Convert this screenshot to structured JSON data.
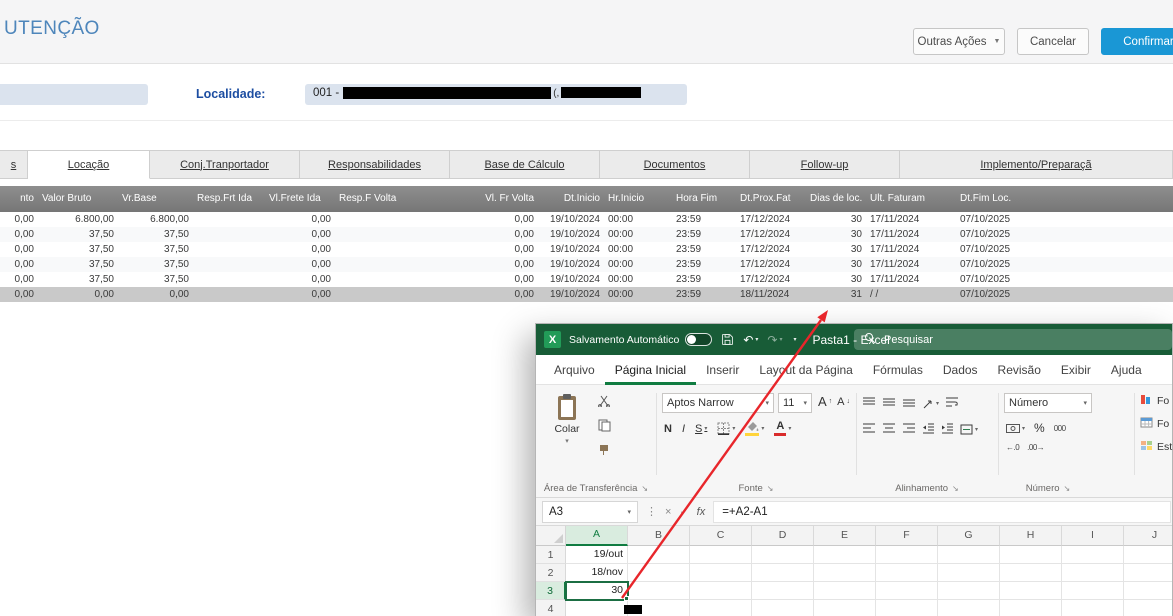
{
  "colors": {
    "accent_blue": "#1a97d5",
    "title_blue": "#4e86bb",
    "label_blue": "#1c4da1",
    "excel_green": "#185c37",
    "excel_accent": "#107c41",
    "arrow_red": "#e8262b",
    "grid_header": "#828282",
    "selected_row": "#c9c9c9",
    "field_bg": "#dbe3ee"
  },
  "header": {
    "title": "UTENÇÃO",
    "outras_acoes_label": "Outras Ações",
    "cancelar_label": "Cancelar",
    "confirmar_label": "Confirmar"
  },
  "form": {
    "localidade_label": "Localidade:",
    "localidade_value": "001 -",
    "redacted_fragment": "(,"
  },
  "tabs": [
    {
      "label": "s",
      "active": false
    },
    {
      "label": "Locação",
      "active": true
    },
    {
      "label": "Conj.Tranportador",
      "active": false
    },
    {
      "label": "Responsabilidades",
      "active": false
    },
    {
      "label": "Base de Cálculo",
      "active": false
    },
    {
      "label": "Documentos",
      "active": false
    },
    {
      "label": "Follow-up",
      "active": false
    },
    {
      "label": "Implemento/Preparaçã",
      "active": false
    }
  ],
  "grid": {
    "columns": [
      "nto",
      "Valor Bruto",
      "Vr.Base",
      "Resp.Frt Ida",
      "Vl.Frete Ida",
      "Resp.F Volta",
      "Vl. Fr Volta",
      "Dt.Inicio",
      "Hr.Inicio",
      "Hora Fim",
      "Dt.Prox.Fat",
      "Dias de loc.",
      "Ult. Faturam",
      "Dt.Fim Loc."
    ],
    "selected_row_index": 5,
    "rows": [
      [
        "0,00",
        "6.800,00",
        "6.800,00",
        "",
        "0,00",
        "",
        "0,00",
        "19/10/2024",
        "00:00",
        "23:59",
        "17/12/2024",
        "30",
        "17/11/2024",
        "07/10/2025"
      ],
      [
        "0,00",
        "37,50",
        "37,50",
        "",
        "0,00",
        "",
        "0,00",
        "19/10/2024",
        "00:00",
        "23:59",
        "17/12/2024",
        "30",
        "17/11/2024",
        "07/10/2025"
      ],
      [
        "0,00",
        "37,50",
        "37,50",
        "",
        "0,00",
        "",
        "0,00",
        "19/10/2024",
        "00:00",
        "23:59",
        "17/12/2024",
        "30",
        "17/11/2024",
        "07/10/2025"
      ],
      [
        "0,00",
        "37,50",
        "37,50",
        "",
        "0,00",
        "",
        "0,00",
        "19/10/2024",
        "00:00",
        "23:59",
        "17/12/2024",
        "30",
        "17/11/2024",
        "07/10/2025"
      ],
      [
        "0,00",
        "37,50",
        "37,50",
        "",
        "0,00",
        "",
        "0,00",
        "19/10/2024",
        "00:00",
        "23:59",
        "17/12/2024",
        "30",
        "17/11/2024",
        "07/10/2025"
      ],
      [
        "0,00",
        "0,00",
        "0,00",
        "",
        "0,00",
        "",
        "0,00",
        "19/10/2024",
        "00:00",
        "23:59",
        "18/11/2024",
        "31",
        "/ /",
        "07/10/2025"
      ]
    ]
  },
  "excel": {
    "titlebar": {
      "autosave_label": "Salvamento Automático",
      "title": "Pasta1 - Excel",
      "search_placeholder": "Pesquisar",
      "app_initial": "X"
    },
    "menu": [
      "Arquivo",
      "Página Inicial",
      "Inserir",
      "Layout da Página",
      "Fórmulas",
      "Dados",
      "Revisão",
      "Exibir",
      "Ajuda"
    ],
    "active_tab": "Página Inicial",
    "ribbon": {
      "paste_label": "Colar",
      "font_name": "Aptos Narrow",
      "font_size": "11",
      "bold": "N",
      "italic": "I",
      "underline": "S",
      "number_format": "Número",
      "percent": "%",
      "thousands": "000",
      "groups": {
        "clipboard": "Área de Transferência",
        "font": "Fonte",
        "alignment": "Alinhamento",
        "number": "Número"
      },
      "right_items": [
        "Fo",
        "Fo",
        "Est"
      ]
    },
    "formula_bar": {
      "name_box": "A3",
      "fx": "fx",
      "formula": "=+A2-A1"
    },
    "sheet": {
      "col_headers": [
        "A",
        "B",
        "C",
        "D",
        "E",
        "F",
        "G",
        "H",
        "I",
        "J"
      ],
      "row_headers": [
        "1",
        "2",
        "3",
        "4"
      ],
      "cells": {
        "A1": "19/out",
        "A2": "18/nov",
        "A3": "30"
      },
      "selected_cell": "A3"
    }
  }
}
